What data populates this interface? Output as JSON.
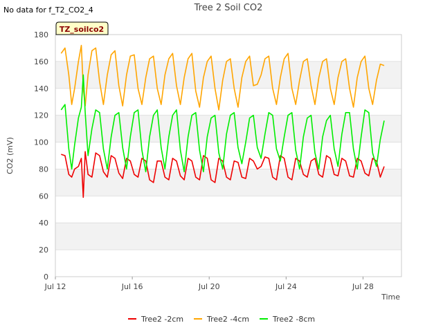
{
  "page": {
    "no_data_note": "No data for f_T2_CO2_4",
    "badge": "TZ_soilco2"
  },
  "chart_data": {
    "type": "line",
    "title": "Tree 2 Soil CO2",
    "xlabel": "Time",
    "ylabel": "CO2 (mV)",
    "x_unit": "days since Jul 12",
    "xlim": [
      0,
      18
    ],
    "ylim": [
      0,
      180
    ],
    "yticks": [
      0,
      20,
      40,
      60,
      80,
      100,
      120,
      140,
      160,
      180
    ],
    "xticks": [
      {
        "value": 0,
        "label": "Jul 12"
      },
      {
        "value": 4,
        "label": "Jul 16"
      },
      {
        "value": 8,
        "label": "Jul 20"
      },
      {
        "value": 12,
        "label": "Jul 24"
      },
      {
        "value": 16,
        "label": "Jul 28"
      }
    ],
    "grid": "horizontal bands",
    "legend_position": "bottom",
    "series": [
      {
        "name": "Tree2 -2cm",
        "color": "#ee0000",
        "x": [
          0.3,
          0.5,
          0.7,
          0.85,
          1.0,
          1.2,
          1.35,
          1.45,
          1.55,
          1.7,
          1.9,
          2.1,
          2.3,
          2.5,
          2.7,
          2.9,
          3.1,
          3.3,
          3.5,
          3.7,
          3.9,
          4.1,
          4.3,
          4.5,
          4.7,
          4.9,
          5.1,
          5.3,
          5.5,
          5.7,
          5.9,
          6.1,
          6.3,
          6.5,
          6.7,
          6.9,
          7.1,
          7.3,
          7.5,
          7.7,
          7.9,
          8.1,
          8.3,
          8.5,
          8.7,
          8.9,
          9.1,
          9.3,
          9.5,
          9.7,
          9.9,
          10.1,
          10.3,
          10.5,
          10.7,
          10.9,
          11.1,
          11.3,
          11.5,
          11.7,
          11.9,
          12.1,
          12.3,
          12.5,
          12.7,
          12.9,
          13.1,
          13.3,
          13.5,
          13.7,
          13.9,
          14.1,
          14.3,
          14.5,
          14.7,
          14.9,
          15.1,
          15.3,
          15.5,
          15.7,
          15.9,
          16.1,
          16.3,
          16.5,
          16.7,
          16.9,
          17.1
        ],
        "y": [
          91,
          90,
          76,
          74,
          80,
          82,
          88,
          59,
          93,
          76,
          74,
          92,
          90,
          78,
          74,
          90,
          88,
          77,
          73,
          88,
          86,
          76,
          74,
          88,
          86,
          72,
          70,
          86,
          86,
          74,
          72,
          88,
          86,
          75,
          72,
          88,
          86,
          74,
          72,
          90,
          88,
          72,
          70,
          88,
          86,
          74,
          72,
          86,
          85,
          74,
          73,
          88,
          86,
          80,
          82,
          89,
          88,
          74,
          72,
          90,
          88,
          74,
          72,
          88,
          86,
          76,
          74,
          86,
          88,
          76,
          74,
          90,
          88,
          76,
          75,
          88,
          86,
          75,
          74,
          88,
          86,
          77,
          75,
          88,
          86,
          74,
          82
        ]
      },
      {
        "name": "Tree2 -4cm",
        "color": "#ffa500",
        "x": [
          0.3,
          0.5,
          0.7,
          0.85,
          1.0,
          1.2,
          1.35,
          1.45,
          1.55,
          1.7,
          1.9,
          2.1,
          2.3,
          2.5,
          2.7,
          2.9,
          3.1,
          3.3,
          3.5,
          3.7,
          3.9,
          4.1,
          4.3,
          4.5,
          4.7,
          4.9,
          5.1,
          5.3,
          5.5,
          5.7,
          5.9,
          6.1,
          6.3,
          6.5,
          6.7,
          6.9,
          7.1,
          7.3,
          7.5,
          7.7,
          7.9,
          8.1,
          8.3,
          8.5,
          8.7,
          8.9,
          9.1,
          9.3,
          9.5,
          9.7,
          9.9,
          10.1,
          10.3,
          10.5,
          10.7,
          10.9,
          11.1,
          11.3,
          11.5,
          11.7,
          11.9,
          12.1,
          12.3,
          12.5,
          12.7,
          12.9,
          13.1,
          13.3,
          13.5,
          13.7,
          13.9,
          14.1,
          14.3,
          14.5,
          14.7,
          14.9,
          15.1,
          15.3,
          15.5,
          15.7,
          15.9,
          16.1,
          16.3,
          16.5,
          16.7,
          16.9,
          17.1
        ],
        "y": [
          166,
          170,
          150,
          128,
          140,
          160,
          172,
          140,
          127,
          150,
          168,
          170,
          145,
          128,
          150,
          165,
          168,
          142,
          127,
          150,
          164,
          165,
          140,
          128,
          148,
          162,
          164,
          140,
          128,
          150,
          162,
          166,
          142,
          128,
          148,
          162,
          166,
          138,
          126,
          148,
          160,
          164,
          140,
          124,
          146,
          160,
          162,
          140,
          126,
          148,
          160,
          164,
          142,
          143,
          150,
          162,
          164,
          140,
          128,
          148,
          162,
          166,
          140,
          128,
          146,
          160,
          162,
          142,
          128,
          148,
          160,
          162,
          140,
          128,
          148,
          160,
          162,
          140,
          126,
          148,
          160,
          164,
          140,
          128,
          146,
          158,
          157
        ]
      },
      {
        "name": "Tree2 -8cm",
        "color": "#00ee00",
        "x": [
          0.3,
          0.5,
          0.7,
          0.85,
          1.0,
          1.2,
          1.35,
          1.45,
          1.55,
          1.7,
          1.9,
          2.1,
          2.3,
          2.5,
          2.7,
          2.9,
          3.1,
          3.3,
          3.5,
          3.7,
          3.9,
          4.1,
          4.3,
          4.5,
          4.7,
          4.9,
          5.1,
          5.3,
          5.5,
          5.7,
          5.9,
          6.1,
          6.3,
          6.5,
          6.7,
          6.9,
          7.1,
          7.3,
          7.5,
          7.7,
          7.9,
          8.1,
          8.3,
          8.5,
          8.7,
          8.9,
          9.1,
          9.3,
          9.5,
          9.7,
          9.9,
          10.1,
          10.3,
          10.5,
          10.7,
          10.9,
          11.1,
          11.3,
          11.5,
          11.7,
          11.9,
          12.1,
          12.3,
          12.5,
          12.7,
          12.9,
          13.1,
          13.3,
          13.5,
          13.7,
          13.9,
          14.1,
          14.3,
          14.5,
          14.7,
          14.9,
          15.1,
          15.3,
          15.5,
          15.7,
          15.9,
          16.1,
          16.3,
          16.5,
          16.7,
          16.9,
          17.1
        ],
        "y": [
          124,
          128,
          95,
          80,
          98,
          118,
          126,
          150,
          122,
          90,
          110,
          124,
          122,
          95,
          80,
          104,
          120,
          122,
          96,
          80,
          104,
          122,
          124,
          94,
          78,
          104,
          120,
          124,
          96,
          80,
          104,
          120,
          124,
          94,
          78,
          104,
          120,
          122,
          94,
          78,
          104,
          118,
          120,
          92,
          80,
          106,
          120,
          122,
          96,
          84,
          100,
          118,
          120,
          96,
          88,
          106,
          122,
          120,
          95,
          86,
          104,
          120,
          122,
          94,
          80,
          104,
          118,
          120,
          92,
          80,
          104,
          116,
          120,
          95,
          82,
          106,
          122,
          122,
          95,
          80,
          104,
          124,
          122,
          92,
          82,
          102,
          116
        ]
      }
    ]
  }
}
